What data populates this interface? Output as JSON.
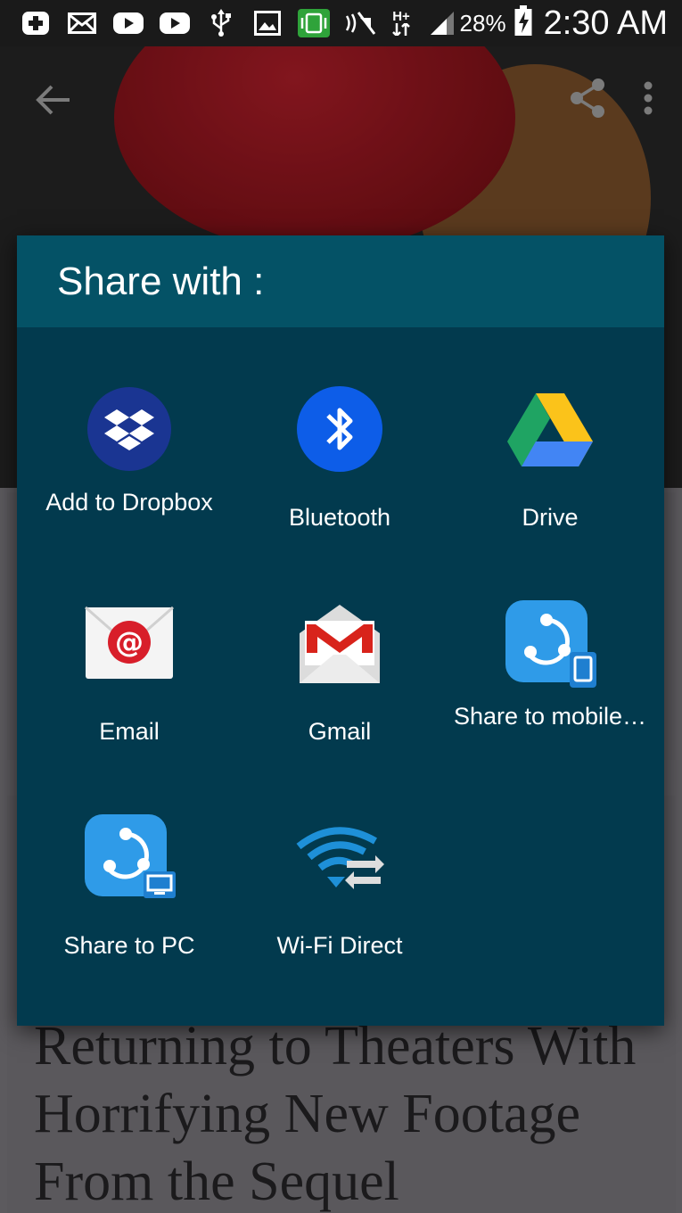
{
  "status_bar": {
    "battery_percent": "28%",
    "time": "2:30 AM",
    "network_type": "H+",
    "icons": [
      "plus-icon",
      "mail-icon",
      "youtube-icon",
      "youtube-icon",
      "usb-icon",
      "gallery-icon",
      "screen-mirror-icon",
      "nfc-mute-icon",
      "data-arrows-icon",
      "signal-icon",
      "battery-charging-icon"
    ]
  },
  "app_bar": {
    "icons": [
      "back-arrow-icon",
      "share-icon",
      "more-vert-icon"
    ]
  },
  "article": {
    "headline": "Returning to Theaters With Horrifying New Footage From the Sequel"
  },
  "share_dialog": {
    "title": "Share with :",
    "items": [
      {
        "label": "Add to Dropbox",
        "icon": "dropbox-icon"
      },
      {
        "label": "Bluetooth",
        "icon": "bluetooth-icon"
      },
      {
        "label": "Drive",
        "icon": "google-drive-icon"
      },
      {
        "label": "Email",
        "icon": "email-icon"
      },
      {
        "label": "Gmail",
        "icon": "gmail-icon"
      },
      {
        "label": "Share to mobile…",
        "icon": "shareit-mobile-icon"
      },
      {
        "label": "Share to PC",
        "icon": "shareit-pc-icon"
      },
      {
        "label": "Wi-Fi Direct",
        "icon": "wifi-direct-icon"
      }
    ]
  },
  "colors": {
    "dialog_bg": "#023a4e",
    "dialog_header": "#045266",
    "status_bar": "#1a1a1a"
  }
}
